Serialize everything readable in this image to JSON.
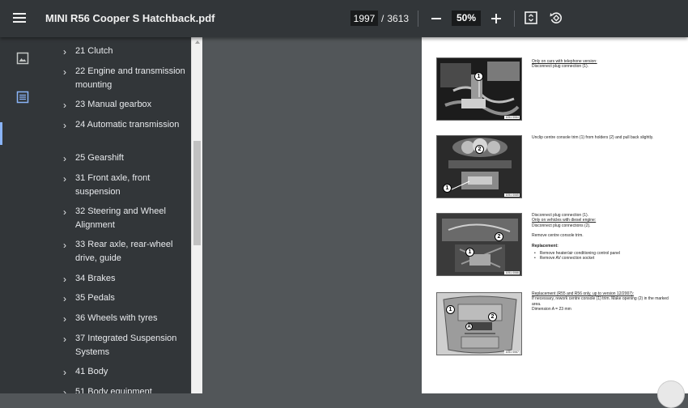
{
  "toolbar": {
    "title": "MINI R56 Cooper S Hatchback.pdf",
    "current_page": "1997",
    "separator": "/",
    "total_pages": "3613",
    "zoom": "50%"
  },
  "sidebar": {
    "items": [
      {
        "label": "21 Clutch"
      },
      {
        "label": "22 Engine and transmission mounting"
      },
      {
        "label": "23 Manual gearbox"
      },
      {
        "label": "24 Automatic transmission"
      },
      {
        "label": "25 Gearshift"
      },
      {
        "label": "31 Front axle, front suspension"
      },
      {
        "label": "32 Steering and Wheel Alignment"
      },
      {
        "label": "33 Rear axle, rear-wheel drive, guide"
      },
      {
        "label": "34 Brakes"
      },
      {
        "label": "35 Pedals"
      },
      {
        "label": "36 Wheels with tyres"
      },
      {
        "label": "37 Integrated Suspension Systems"
      },
      {
        "label": "41 Body"
      },
      {
        "label": "51 Body equipment"
      }
    ]
  },
  "page": {
    "figures": [
      {
        "id": "1051 0064",
        "callouts": [
          "1"
        ]
      },
      {
        "id": "1051 0065",
        "callouts": [
          "2",
          "1"
        ]
      },
      {
        "id": "1051 0066",
        "callouts": [
          "2",
          "1"
        ]
      },
      {
        "id": "1051 0067",
        "callouts": [
          "1",
          "2",
          "A"
        ]
      }
    ],
    "block1": {
      "line1": "Only on cars with telephone version:",
      "line2": "Disconnect plug connection (1)."
    },
    "block2": {
      "line1": "Unclip centre console trim (1) from holders (2) and pull back slightly."
    },
    "block3": {
      "line1": "Disconnect plug connection (1).",
      "line2": "Only on vehicles with diesel engine:",
      "line3": "Disconnect plug connections (2).",
      "line4": "Remove centre console trim.",
      "line5": "Replacement:",
      "line6": "Remove heater/air conditioning control panel",
      "line7": "Remove AV connection socket"
    },
    "block4": {
      "line1": "Replacement (R55 and R56 only, up to version 12/2007):",
      "line2": "If necessary, rework centre console (1) trim. Make opening (2) in the marked area.",
      "line3": "Dimension A = 23 mm"
    }
  }
}
